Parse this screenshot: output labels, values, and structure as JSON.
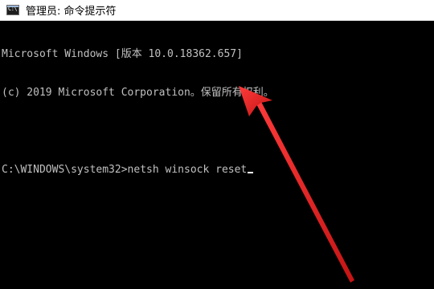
{
  "window": {
    "title": "管理员: 命令提示符",
    "icon_name": "cmd-icon",
    "icon_text": "C:\\",
    "background": "#000000",
    "text_color": "#c0c0c0"
  },
  "console": {
    "line1": "Microsoft Windows [版本 10.0.18362.657]",
    "line2": "(c) 2019 Microsoft Corporation。保留所有权利。",
    "prompt": "C:\\WINDOWS\\system32>",
    "command": "netsh winsock reset"
  },
  "annotation": {
    "arrow_color": "#e02020"
  }
}
